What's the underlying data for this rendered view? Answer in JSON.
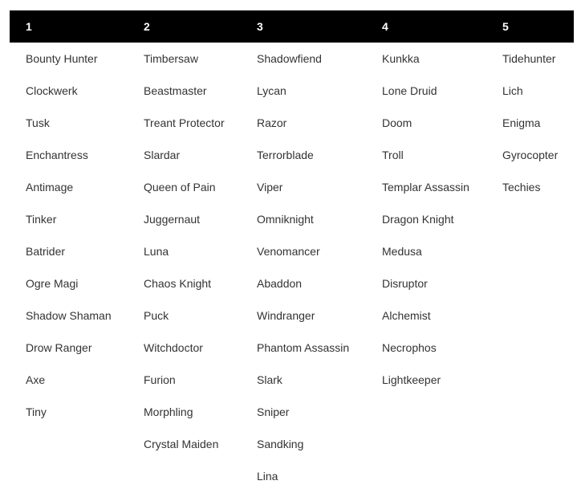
{
  "colors": {
    "header_bg": "#000000",
    "header_text": "#ffffff",
    "cell_text": "#333333",
    "page_bg": "#ffffff"
  },
  "table": {
    "headers": [
      "1",
      "2",
      "3",
      "4",
      "5"
    ],
    "columns": [
      [
        "Bounty Hunter",
        "Clockwerk",
        "Tusk",
        "Enchantress",
        "Antimage",
        "Tinker",
        "Batrider",
        "Ogre Magi",
        "Shadow Shaman",
        "Drow Ranger",
        "Axe",
        "Tiny"
      ],
      [
        "Timbersaw",
        "Beastmaster",
        "Treant Protector",
        "Slardar",
        "Queen of Pain",
        "Juggernaut",
        "Luna",
        "Chaos Knight",
        "Puck",
        "Witchdoctor",
        "Furion",
        "Morphling",
        "Crystal Maiden"
      ],
      [
        "Shadowfiend",
        "Lycan",
        "Razor",
        "Terrorblade",
        "Viper",
        "Omniknight",
        "Venomancer",
        "Abaddon",
        "Windranger",
        "Phantom Assassin",
        "Slark",
        "Sniper",
        "Sandking",
        "Lina"
      ],
      [
        "Kunkka",
        "Lone Druid",
        "Doom",
        "Troll",
        "Templar Assassin",
        "Dragon Knight",
        "Medusa",
        "Disruptor",
        "Alchemist",
        "Necrophos",
        "Lightkeeper"
      ],
      [
        "Tidehunter",
        "Lich",
        "Enigma",
        "Gyrocopter",
        "Techies"
      ]
    ]
  }
}
